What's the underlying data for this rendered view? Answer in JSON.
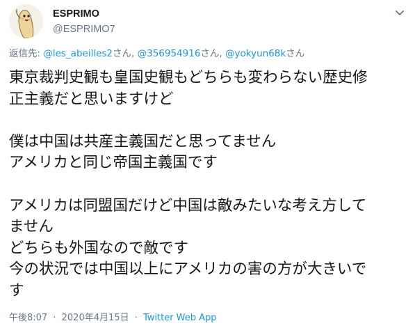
{
  "user": {
    "display_name": "ESPRIMO",
    "handle": "@ESPRIMO7"
  },
  "reply": {
    "prefix": "返信先: ",
    "mentions": [
      {
        "handle": "@les_abeilles2",
        "suffix": "さん, "
      },
      {
        "handle": "@356954916",
        "suffix": "さん, "
      },
      {
        "handle": "@yokyun68k",
        "suffix": "さん"
      }
    ]
  },
  "tweet": {
    "lines": [
      "東京裁判史観も皇国史観もどちらも変わらない歴史修",
      "正主義だと思いますけど",
      "",
      "僕は中国は共産主義国だと思ってません",
      "アメリカと同じ帝国主義国です",
      "",
      "アメリカは同盟国だけど中国は敵みたいな考え方して",
      "ません",
      "どちらも外国なので敵です",
      "今の状況では中国以上にアメリカの害の方が大きいで",
      "す"
    ]
  },
  "meta": {
    "time": "午後8:07",
    "separator": "·",
    "date": "2020年4月15日",
    "source": "Twitter Web App"
  },
  "icons": {
    "avatar": "cartoon-character-avatar",
    "caret": "chevron-down-icon"
  },
  "colors": {
    "text": "#14171a",
    "secondary": "#657786",
    "link": "#1b95e0"
  }
}
